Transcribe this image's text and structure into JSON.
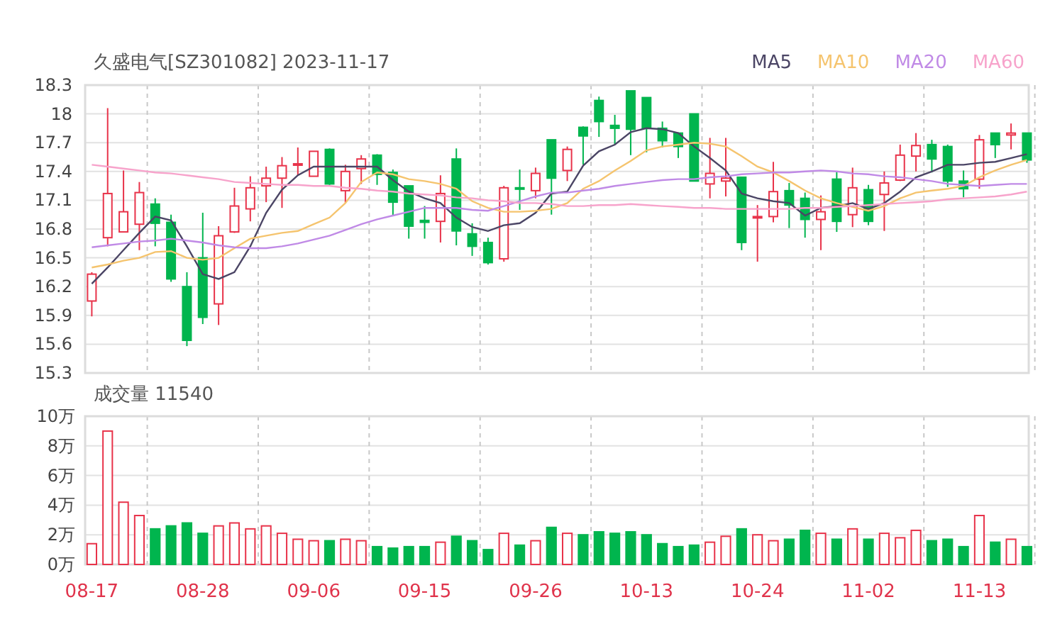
{
  "price_chart": {
    "chart_data": {
      "type": "candlestick",
      "title": "久盛电气[SZ301082] 2023-11-17",
      "grid": true,
      "ylim": [
        15.3,
        18.3
      ],
      "yticks": [
        18.3,
        {
          "value": 18,
          "label": "18"
        },
        17.7,
        17.4,
        17.1,
        16.8,
        16.5,
        16.2,
        15.9,
        15.6,
        15.3
      ],
      "ohlc": [
        [
          16.05,
          16.35,
          15.89,
          16.33
        ],
        [
          16.71,
          18.06,
          16.62,
          17.17
        ],
        [
          16.77,
          17.41,
          16.77,
          16.98
        ],
        [
          16.85,
          17.29,
          16.58,
          17.18
        ],
        [
          17.06,
          17.12,
          16.62,
          16.86
        ],
        [
          16.87,
          16.95,
          16.25,
          16.28
        ],
        [
          16.2,
          16.35,
          15.58,
          15.64
        ],
        [
          16.5,
          16.97,
          15.81,
          15.88
        ],
        [
          16.02,
          16.83,
          15.8,
          16.73
        ],
        [
          16.77,
          17.23,
          16.76,
          17.04
        ],
        [
          17.01,
          17.35,
          16.88,
          17.23
        ],
        [
          17.25,
          17.45,
          17.08,
          17.33
        ],
        [
          17.33,
          17.55,
          17.02,
          17.46
        ],
        [
          17.47,
          17.65,
          17.36,
          17.48
        ],
        [
          17.35,
          17.61,
          17.35,
          17.61
        ],
        [
          17.63,
          17.64,
          17.26,
          17.27
        ],
        [
          17.2,
          17.47,
          17.07,
          17.4
        ],
        [
          17.43,
          17.57,
          17.27,
          17.53
        ],
        [
          17.57,
          17.58,
          17.26,
          17.37
        ],
        [
          17.39,
          17.42,
          16.94,
          17.08
        ],
        [
          17.25,
          17.25,
          16.7,
          16.83
        ],
        [
          16.89,
          17.04,
          16.7,
          16.87
        ],
        [
          16.88,
          17.36,
          16.66,
          17.17
        ],
        [
          17.53,
          17.64,
          16.63,
          16.78
        ],
        [
          16.75,
          16.86,
          16.52,
          16.62
        ],
        [
          16.66,
          16.71,
          16.43,
          16.45
        ],
        [
          16.49,
          17.25,
          16.46,
          17.23
        ],
        [
          17.23,
          17.42,
          17.0,
          17.22
        ],
        [
          17.2,
          17.44,
          17.12,
          17.38
        ],
        [
          17.73,
          17.73,
          16.95,
          17.33
        ],
        [
          17.41,
          17.66,
          17.3,
          17.63
        ],
        [
          17.86,
          17.87,
          17.47,
          17.77
        ],
        [
          18.14,
          18.18,
          17.76,
          17.92
        ],
        [
          17.88,
          17.99,
          17.68,
          17.85
        ],
        [
          18.24,
          18.24,
          17.57,
          17.84
        ],
        [
          18.17,
          18.17,
          17.6,
          17.85
        ],
        [
          17.85,
          17.92,
          17.65,
          17.72
        ],
        [
          17.8,
          17.8,
          17.54,
          17.66
        ],
        [
          18.0,
          18.0,
          17.3,
          17.3
        ],
        [
          17.27,
          17.75,
          17.12,
          17.38
        ],
        [
          17.3,
          17.75,
          17.14,
          17.33
        ],
        [
          17.34,
          17.34,
          16.58,
          16.66
        ],
        [
          16.92,
          17.05,
          16.46,
          16.93
        ],
        [
          16.93,
          17.5,
          16.87,
          17.19
        ],
        [
          17.2,
          17.28,
          16.81,
          17.05
        ],
        [
          17.12,
          17.18,
          16.71,
          16.9
        ],
        [
          16.9,
          17.15,
          16.58,
          16.98
        ],
        [
          17.32,
          17.4,
          16.77,
          16.88
        ],
        [
          16.95,
          17.44,
          16.82,
          17.23
        ],
        [
          17.21,
          17.26,
          16.84,
          16.88
        ],
        [
          17.16,
          17.4,
          16.78,
          17.28
        ],
        [
          17.31,
          17.68,
          17.3,
          17.57
        ],
        [
          17.56,
          17.8,
          17.4,
          17.67
        ],
        [
          17.68,
          17.73,
          17.39,
          17.53
        ],
        [
          17.66,
          17.68,
          17.24,
          17.3
        ],
        [
          17.3,
          17.41,
          17.13,
          17.22
        ],
        [
          17.32,
          17.78,
          17.22,
          17.73
        ],
        [
          17.8,
          17.8,
          17.54,
          17.68
        ],
        [
          17.78,
          17.9,
          17.63,
          17.8
        ],
        [
          17.8,
          17.8,
          17.49,
          17.52
        ]
      ]
    },
    "moving_averages": {
      "chart_data": {
        "type": "line",
        "ylim": [
          15.3,
          18.3
        ],
        "series": [
          {
            "name": "MA5",
            "color": "#4b4565",
            "values": [
              16.23,
              16.4,
              16.58,
              16.76,
              16.93,
              16.89,
              16.62,
              16.33,
              16.28,
              16.35,
              16.62,
              16.97,
              17.21,
              17.36,
              17.45,
              17.45,
              17.45,
              17.45,
              17.45,
              17.31,
              17.19,
              17.12,
              17.07,
              16.92,
              16.82,
              16.78,
              16.84,
              16.86,
              16.97,
              17.17,
              17.19,
              17.46,
              17.61,
              17.68,
              17.81,
              17.85,
              17.84,
              17.8,
              17.66,
              17.54,
              17.41,
              17.17,
              17.12,
              17.09,
              17.07,
              16.94,
              17.02,
              17.04,
              17.07,
              17.01,
              17.07,
              17.19,
              17.34,
              17.4,
              17.47,
              17.47,
              17.49,
              17.5,
              17.54,
              17.58
            ]
          },
          {
            "name": "MA10",
            "color": "#f5c46e",
            "values": [
              16.4,
              16.43,
              16.47,
              16.5,
              16.56,
              16.57,
              16.5,
              16.48,
              16.5,
              16.6,
              16.7,
              16.73,
              16.76,
              16.78,
              16.85,
              16.92,
              17.07,
              17.29,
              17.39,
              17.37,
              17.32,
              17.3,
              17.27,
              17.22,
              17.09,
              17.02,
              16.98,
              16.98,
              16.99,
              17.01,
              17.07,
              17.22,
              17.3,
              17.41,
              17.51,
              17.62,
              17.66,
              17.68,
              17.7,
              17.69,
              17.66,
              17.56,
              17.45,
              17.39,
              17.3,
              17.2,
              17.12,
              17.07,
              17.03,
              16.99,
              17.04,
              17.12,
              17.18,
              17.2,
              17.22,
              17.25,
              17.34,
              17.41,
              17.47,
              17.52
            ]
          },
          {
            "name": "MA20",
            "color": "#c08ae6",
            "values": [
              16.61,
              16.63,
              16.65,
              16.67,
              16.68,
              16.7,
              16.68,
              16.66,
              16.63,
              16.61,
              16.6,
              16.6,
              16.62,
              16.65,
              16.69,
              16.73,
              16.79,
              16.85,
              16.9,
              16.94,
              16.98,
              17.02,
              17.02,
              17.02,
              17.0,
              16.99,
              17.04,
              17.09,
              17.14,
              17.18,
              17.18,
              17.2,
              17.22,
              17.25,
              17.27,
              17.29,
              17.31,
              17.32,
              17.32,
              17.34,
              17.35,
              17.37,
              17.38,
              17.39,
              17.39,
              17.4,
              17.41,
              17.4,
              17.38,
              17.37,
              17.35,
              17.34,
              17.32,
              17.3,
              17.27,
              17.26,
              17.25,
              17.26,
              17.27,
              17.27
            ]
          },
          {
            "name": "MA60",
            "color": "#f7a3cb",
            "values": [
              17.47,
              17.45,
              17.43,
              17.41,
              17.39,
              17.38,
              17.36,
              17.34,
              17.32,
              17.29,
              17.28,
              17.27,
              17.26,
              17.26,
              17.25,
              17.25,
              17.23,
              17.22,
              17.2,
              17.19,
              17.17,
              17.16,
              17.15,
              17.13,
              17.12,
              17.1,
              17.09,
              17.07,
              17.07,
              17.06,
              17.04,
              17.04,
              17.05,
              17.05,
              17.06,
              17.05,
              17.04,
              17.03,
              17.02,
              17.02,
              17.01,
              17.01,
              17.01,
              17.01,
              17.01,
              17.02,
              17.02,
              17.03,
              17.04,
              17.05,
              17.06,
              17.07,
              17.08,
              17.09,
              17.11,
              17.12,
              17.13,
              17.14,
              17.16,
              17.19
            ]
          }
        ]
      }
    }
  },
  "volume_chart": {
    "chart_data": {
      "type": "bar",
      "title": "成交量 11540",
      "grid": true,
      "ylim": [
        0,
        10
      ],
      "yticks": [
        {
          "value": 10,
          "label": "10万"
        },
        {
          "value": 8,
          "label": "8万"
        },
        {
          "value": 6,
          "label": "6万"
        },
        {
          "value": 4,
          "label": "4万"
        },
        {
          "value": 2,
          "label": "2万"
        },
        {
          "value": 0,
          "label": "0万"
        }
      ],
      "categories": [
        "08-17",
        null,
        null,
        null,
        null,
        null,
        null,
        "08-28",
        null,
        null,
        null,
        null,
        null,
        null,
        "09-06",
        null,
        null,
        null,
        null,
        null,
        null,
        "09-15",
        null,
        null,
        null,
        null,
        null,
        null,
        "09-26",
        null,
        null,
        null,
        null,
        null,
        null,
        "10-13",
        null,
        null,
        null,
        null,
        null,
        null,
        "10-24",
        null,
        null,
        null,
        null,
        null,
        null,
        "11-02",
        null,
        null,
        null,
        null,
        null,
        null,
        "11-13",
        null,
        null,
        null
      ],
      "values": [
        1.4,
        9.0,
        4.2,
        3.3,
        2.4,
        2.6,
        2.8,
        2.1,
        2.6,
        2.8,
        2.4,
        2.6,
        2.1,
        1.7,
        1.6,
        1.6,
        1.7,
        1.6,
        1.2,
        1.1,
        1.2,
        1.2,
        1.5,
        1.9,
        1.6,
        1.0,
        2.1,
        1.3,
        1.6,
        2.5,
        2.1,
        2.0,
        2.2,
        2.1,
        2.2,
        2.0,
        1.4,
        1.2,
        1.3,
        1.5,
        1.9,
        2.4,
        2.0,
        1.6,
        1.7,
        2.3,
        2.1,
        1.7,
        2.4,
        1.7,
        2.1,
        1.8,
        2.3,
        1.6,
        1.7,
        1.2,
        3.3,
        1.5,
        1.7,
        1.2
      ]
    }
  }
}
